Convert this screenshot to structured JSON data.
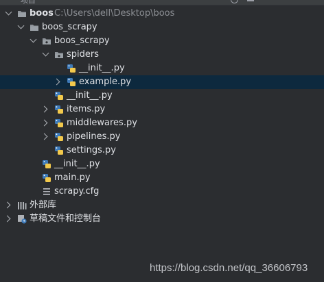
{
  "header": {
    "title": "项目"
  },
  "tree": {
    "root": {
      "label": "boos",
      "path": "C:\\Users\\dell\\Desktop\\boos"
    },
    "project": {
      "label": "boos_scrapy"
    },
    "package": {
      "label": "boos_scrapy"
    },
    "spiders": {
      "label": "spiders"
    },
    "spiders_init": {
      "label": "__init__.py"
    },
    "example": {
      "label": "example.py"
    },
    "package_init": {
      "label": "__init__.py"
    },
    "items": {
      "label": "items.py"
    },
    "middlewares": {
      "label": "middlewares.py"
    },
    "pipelines": {
      "label": "pipelines.py"
    },
    "settings": {
      "label": "settings.py"
    },
    "project_init": {
      "label": "__init__.py"
    },
    "main": {
      "label": "main.py"
    },
    "scrapy_cfg": {
      "label": "scrapy.cfg"
    },
    "external_libs": {
      "label": "外部库"
    },
    "scratches": {
      "label": "草稿文件和控制台"
    }
  },
  "watermark": "https://blog.csdn.net/qq_36606793",
  "colors": {
    "background": "#2b2d30",
    "selection": "#0d293e",
    "folder": "#8e9399",
    "python_blue": "#3e7ab8",
    "python_yellow": "#f2c94c"
  }
}
